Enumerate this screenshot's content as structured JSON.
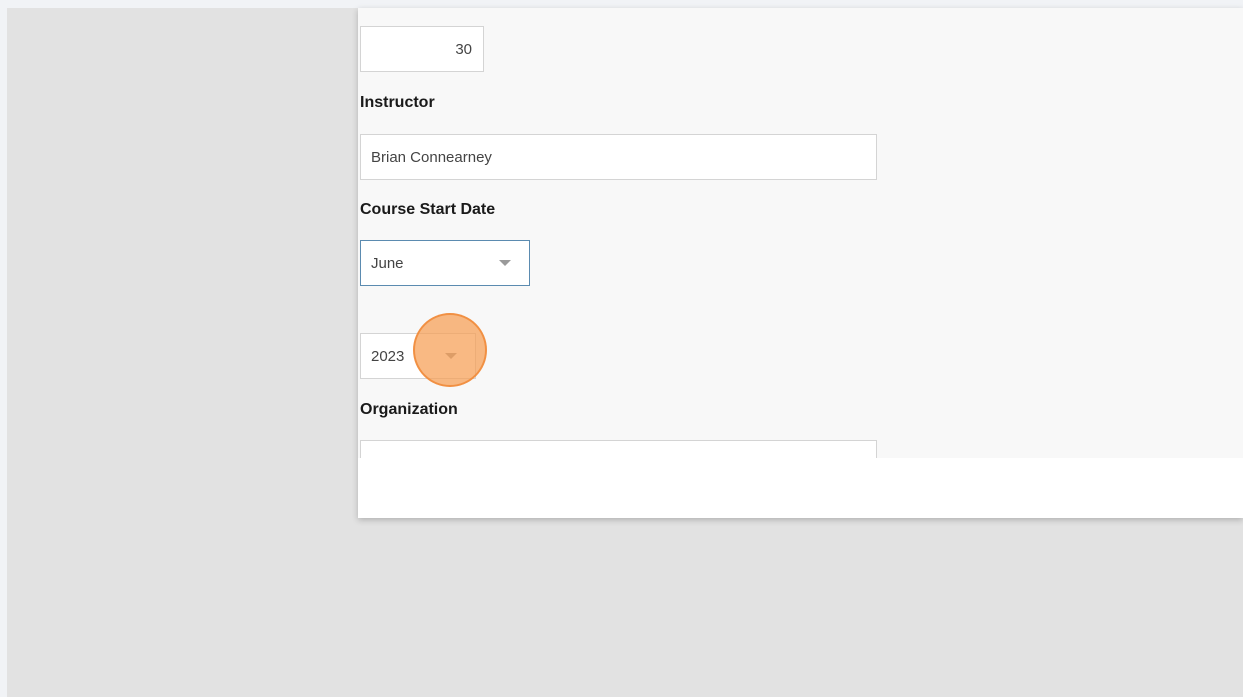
{
  "form": {
    "number_field": {
      "value": "30"
    },
    "instructor": {
      "label": "Instructor",
      "value": "Brian Connearney"
    },
    "course_start_date": {
      "label": "Course Start Date",
      "month": "June",
      "year": "2023"
    },
    "organization": {
      "label": "Organization",
      "value": ""
    }
  },
  "colors": {
    "accent_focus_border": "#5b8bb0",
    "click_marker": "#f79e53"
  },
  "icons": {
    "select_caret": "chevron-down-icon"
  }
}
